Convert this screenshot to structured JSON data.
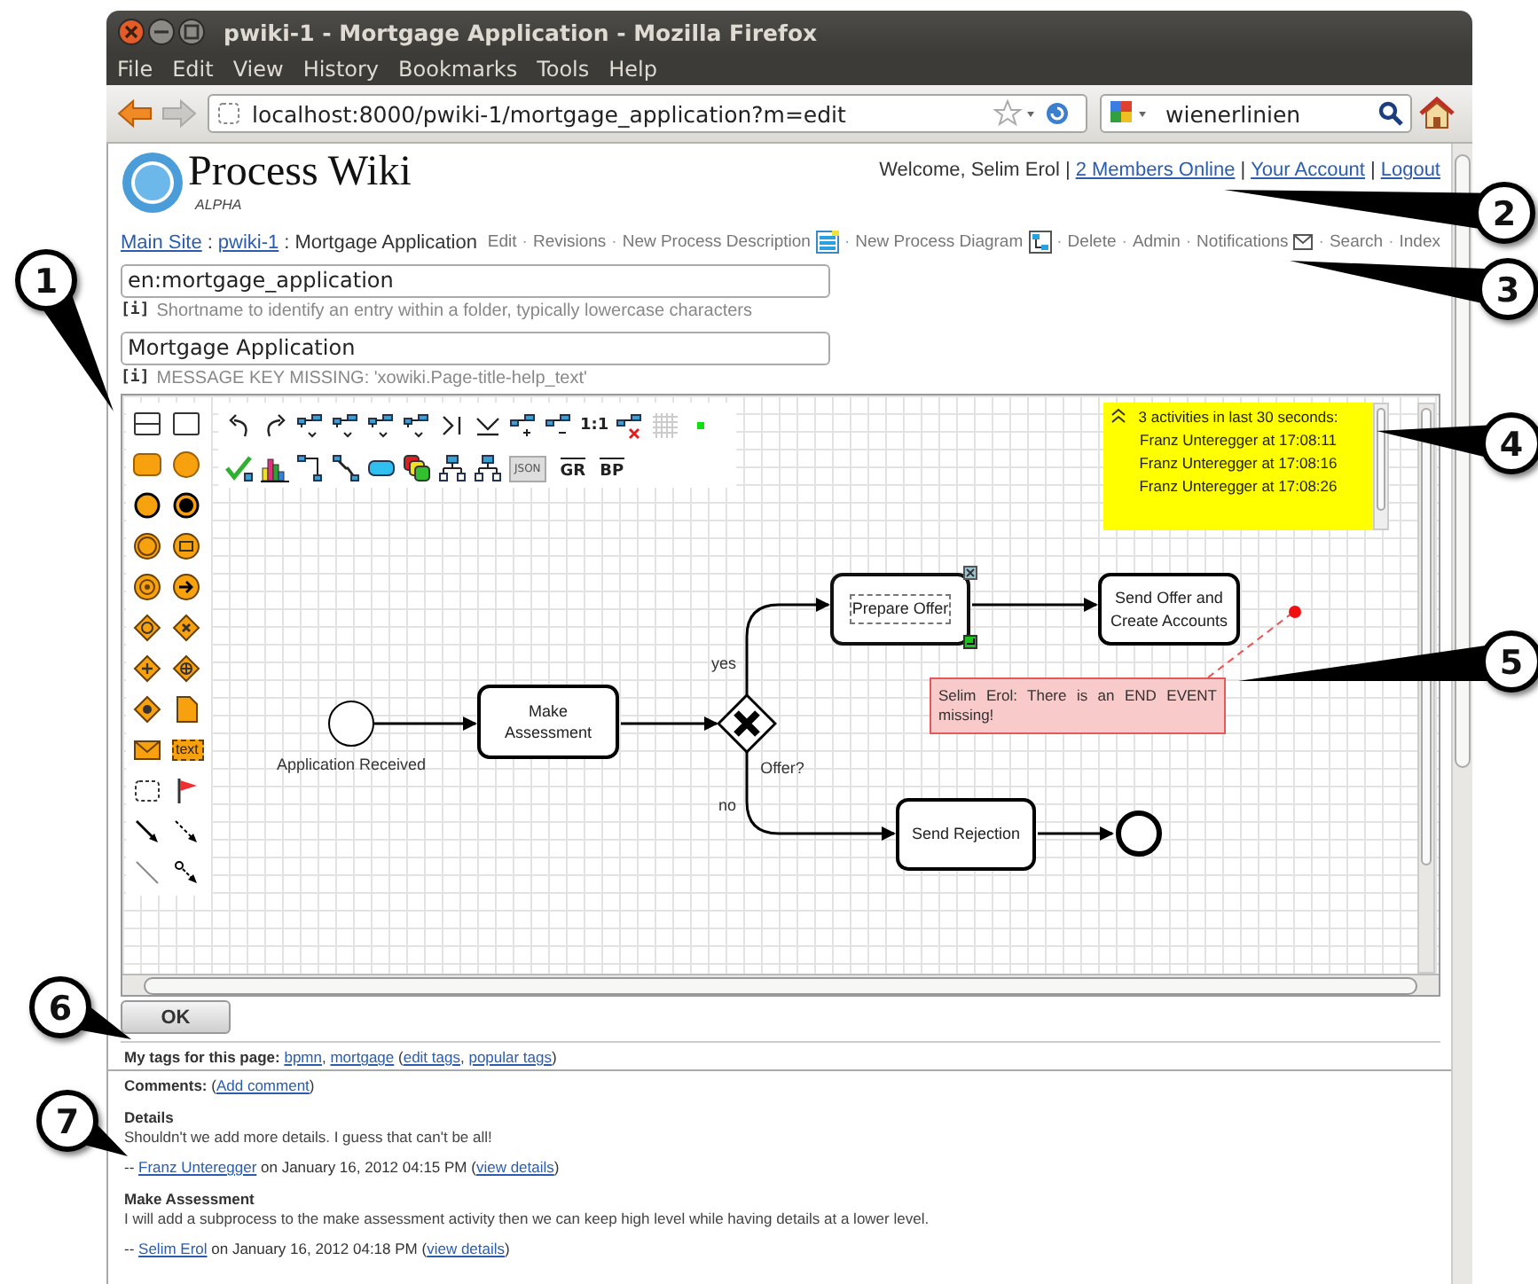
{
  "window": {
    "title": "pwiki-1 - Mortgage Application - Mozilla Firefox"
  },
  "menu": [
    "File",
    "Edit",
    "View",
    "History",
    "Bookmarks",
    "Tools",
    "Help"
  ],
  "address_bar": {
    "value": "localhost:8000/pwiki-1/mortgage_application?m=edit"
  },
  "search_field": {
    "value": "wienerlinien"
  },
  "site": {
    "title": "Process Wiki",
    "subtitle": "ALPHA"
  },
  "user_bar": {
    "welcome": "Welcome, Selim Erol",
    "separator": "|",
    "links": [
      "2 Members Online",
      "Your Account",
      "Logout"
    ]
  },
  "breadcrumb": {
    "separator": ":",
    "items": [
      {
        "label": "Main Site",
        "link": true
      },
      {
        "label": "pwiki-1",
        "link": true
      },
      {
        "label": "Mortgage Application",
        "link": false
      }
    ]
  },
  "actions": {
    "separator": "·",
    "items": [
      {
        "label": "Edit",
        "icon": false
      },
      {
        "label": "Revisions",
        "icon": false
      },
      {
        "label": "New Process Description",
        "icon": true
      },
      {
        "label": "New Process Diagram",
        "icon": true
      },
      {
        "label": "Delete",
        "icon": false
      },
      {
        "label": "Admin",
        "icon": false
      },
      {
        "label": "Notifications",
        "icon": true
      },
      {
        "label": "Search",
        "icon": false
      },
      {
        "label": "Index",
        "icon": false
      }
    ]
  },
  "fields": [
    {
      "value": "en:mortgage_application",
      "info": "[i]",
      "help": "Shortname to identify an entry within a folder, typically lowercase characters"
    },
    {
      "value": "Mortgage Application",
      "info": "[i]",
      "help": "MESSAGE KEY MISSING: 'xowiki.Page-title-help_text'"
    }
  ],
  "editor": {
    "toolbar": {
      "zoom_label": "1:1",
      "export_label": "JSON",
      "layout_labels": [
        "GR",
        "BP"
      ]
    },
    "palette": {
      "note_label": "text"
    },
    "activity": {
      "lines": [
        "3 activities in last 30 seconds:",
        "Franz Unteregger at 17:08:11",
        "Franz Unteregger at 17:08:16",
        "Franz Unteregger at 17:08:26"
      ]
    },
    "diagram": {
      "nodes": [
        {
          "kind": "start",
          "label": "Application Received"
        },
        {
          "kind": "task",
          "label": "Make Assessment",
          "selected": false
        },
        {
          "kind": "gateway",
          "label": "Offer?"
        },
        {
          "kind": "task",
          "label": "Prepare Offer",
          "selected": true
        },
        {
          "kind": "task",
          "label": "Send Offer and Create Accounts",
          "selected": false
        },
        {
          "kind": "task",
          "label": "Send Rejection",
          "selected": false
        },
        {
          "kind": "end"
        }
      ],
      "edge_labels": [
        "yes",
        "no"
      ],
      "comment": "Selim Erol: There is an END EVENT missing!"
    }
  },
  "ok_button": "OK",
  "tags_line": [
    {
      "kind": "bold",
      "text": "My tags for this page: "
    },
    {
      "kind": "link",
      "text": "bpmn"
    },
    {
      "kind": "text",
      "text": ", "
    },
    {
      "kind": "link",
      "text": "mortgage"
    },
    {
      "kind": "text",
      "text": " ("
    },
    {
      "kind": "link",
      "text": "edit tags"
    },
    {
      "kind": "text",
      "text": ", "
    },
    {
      "kind": "link",
      "text": "popular tags"
    },
    {
      "kind": "text",
      "text": ")"
    }
  ],
  "comments_line": [
    {
      "kind": "bold",
      "text": "Comments: "
    },
    {
      "kind": "text",
      "text": "("
    },
    {
      "kind": "link",
      "text": "Add comment"
    },
    {
      "kind": "text",
      "text": ")"
    }
  ],
  "comments": [
    {
      "title": "Details",
      "text": "Shouldn't we add more details. I guess that can't be all!",
      "signature": [
        {
          "kind": "text",
          "text": "-- "
        },
        {
          "kind": "link",
          "text": "Franz Unteregger"
        },
        {
          "kind": "text",
          "text": " on January 16, 2012 04:15 PM ("
        },
        {
          "kind": "link",
          "text": "view details"
        },
        {
          "kind": "text",
          "text": ")"
        }
      ]
    },
    {
      "title": "Make Assessment",
      "text": "I will add a subprocess to the make assessment activity then we can keep high level while having details at a lower level.",
      "signature": [
        {
          "kind": "text",
          "text": "-- "
        },
        {
          "kind": "link",
          "text": "Selim Erol"
        },
        {
          "kind": "text",
          "text": " on January 16, 2012 04:18 PM ("
        },
        {
          "kind": "link",
          "text": "view details"
        },
        {
          "kind": "text",
          "text": ")"
        }
      ]
    }
  ],
  "callouts": [
    "1",
    "6",
    "7",
    "2",
    "3",
    "4",
    "5"
  ]
}
